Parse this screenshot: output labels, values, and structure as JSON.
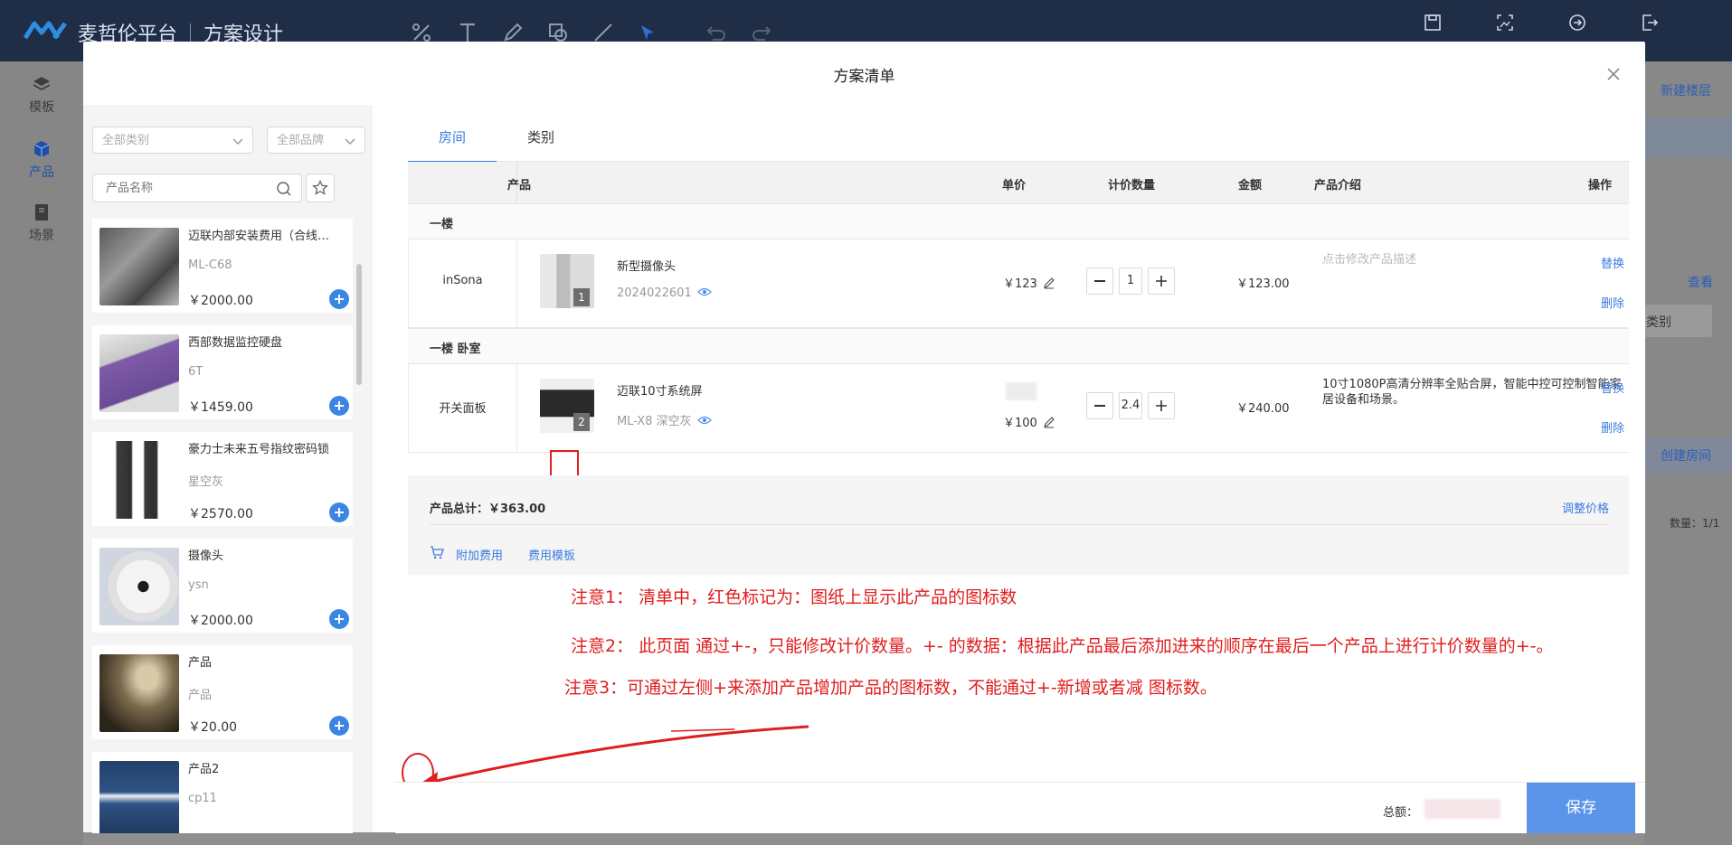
{
  "app": {
    "brand": "麦哲伦平台",
    "section": "方案设计",
    "right_tools": [
      "保存",
      "生成",
      "生成",
      "退出"
    ]
  },
  "left_nav": [
    {
      "label": "模板",
      "icon": "layers-icon"
    },
    {
      "label": "产品",
      "icon": "cube-icon"
    },
    {
      "label": "场景",
      "icon": "book-icon"
    }
  ],
  "right_panel": {
    "new_floor": "新建楼层",
    "view": "查看",
    "category": "类别",
    "create_room": "创建房间",
    "count_label": "数量：1/1"
  },
  "modal": {
    "title": "方案清单",
    "filters": {
      "category_placeholder": "全部类别",
      "brand_placeholder": "全部品牌",
      "search_placeholder": "产品名称"
    },
    "products": [
      {
        "name": "迈联内部安装费用（合线…",
        "code": "ML-C68",
        "price": "￥2000.00"
      },
      {
        "name": "西部数据监控硬盘",
        "code": "6T",
        "price": "￥1459.00"
      },
      {
        "name": "豪力士未来五号指纹密码锁",
        "code": "星空灰",
        "price": "￥2570.00"
      },
      {
        "name": "摄像头",
        "code": "ysn",
        "price": "￥2000.00"
      },
      {
        "name": "产品",
        "code": "产品",
        "price": "￥20.00"
      },
      {
        "name": "产品2",
        "code": "cp11",
        "price": ""
      }
    ],
    "tabs": [
      "房间",
      "类别"
    ],
    "table": {
      "headers": [
        "产品",
        "单价",
        "计价数量",
        "金额",
        "产品介绍",
        "操作"
      ],
      "groups": [
        {
          "name": "一楼",
          "rows": [
            {
              "room": "inSona",
              "product": "新型摄像头",
              "code": "2024022601",
              "badge": "1",
              "unit_price": "￥123",
              "qty": "1",
              "amount": "￥123.00",
              "desc": "点击修改产品描述",
              "op_replace": "替换",
              "op_delete": "删除"
            }
          ]
        },
        {
          "name": "一楼 卧室",
          "rows": [
            {
              "room": "开关面板",
              "product": "迈联10寸系统屏",
              "code": "ML-X8 深空灰",
              "badge": "2",
              "unit_price": "￥100",
              "qty": "2.4",
              "amount": "￥240.00",
              "desc": "10寸1080P高清分辨率全贴合屏，智能中控可控制智能家居设备和场景。",
              "op_replace": "替换",
              "op_delete": "删除"
            }
          ]
        }
      ]
    },
    "summary": {
      "total": "产品总计：￥363.00",
      "adjust": "调整价格",
      "extra_fee": "附加费用",
      "fee_template": "费用模板"
    },
    "notes": [
      "注意1：  清单中，红色标记为：图纸上显示此产品的图标数",
      "注意2：  此页面 通过+-，只能修改计价数量。+- 的数据：根据此产品最后添加进来的顺序在最后一个产品上进行计价数量的+-。",
      "注意3：可通过左侧+来添加产品增加产品的图标数，不能通过+-新增或者减 图标数。"
    ],
    "footer": {
      "total_label": "总额：",
      "save": "保存"
    }
  },
  "colors": {
    "accent": "#3a7be0",
    "annotation": "#e01d1d",
    "topbar": "#1f2d47"
  }
}
